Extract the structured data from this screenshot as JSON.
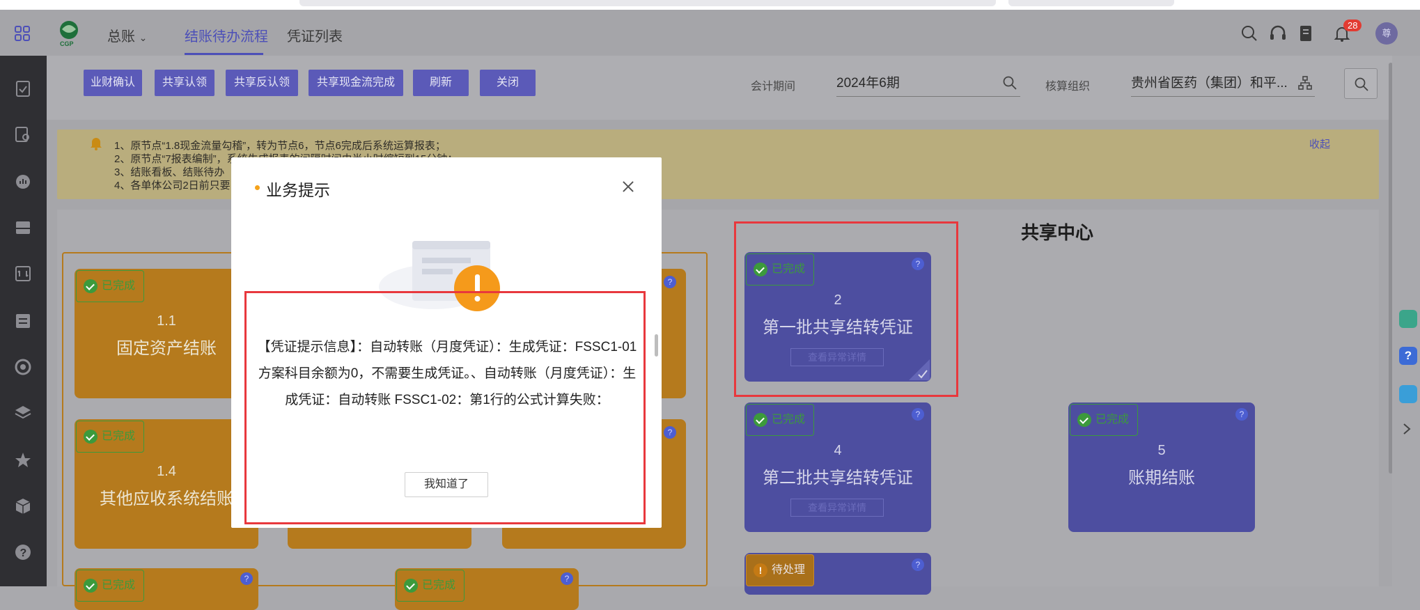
{
  "header": {
    "ledger_label": "总账",
    "tabs": [
      "结账待办流程",
      "凭证列表"
    ],
    "notification_count": "28",
    "avatar_text": "尊"
  },
  "toolbar": {
    "buttons": [
      "业财确认",
      "共享认领",
      "共享反认领",
      "共享现金流完成",
      "刷新",
      "关闭"
    ],
    "period_label": "会计期间",
    "period_value": "2024年6期",
    "org_label": "核算组织",
    "org_value": "贵州省医药（集团）和平..."
  },
  "notice": {
    "lines": [
      "1、原节点“1.8现金流量勾稽”，转为节点6，节点6完成后系统运算报表；",
      "2、原节点“7报表编制”，系统生成报表的间隔时间由半小时缩短到15分钟；",
      "3、结账看板、结账待办",
      "4、各单体公司2日前只要"
    ],
    "collapse_label": "收起"
  },
  "cards_left": [
    {
      "status": "已完成",
      "num": "1.1",
      "title": "固定资产结账"
    },
    {
      "status": "已完成",
      "num": "1.4",
      "title": "其他应收系统结账"
    },
    {
      "status": "已完成",
      "num": "",
      "title": ""
    },
    {
      "status": "已完成",
      "num": "",
      "title": ""
    }
  ],
  "shared_center": {
    "title": "共享中心",
    "cards": [
      {
        "status": "已完成",
        "num": "2",
        "title": "第一批共享结转凭证",
        "link": "查看异常详情"
      },
      {
        "status": "已完成",
        "num": "4",
        "title": "第二批共享结转凭证",
        "link": "查看异常详情"
      },
      {
        "status": "已完成",
        "num": "5",
        "title": "账期结账"
      },
      {
        "status": "待处理"
      }
    ]
  },
  "modal": {
    "title": "业务提示",
    "message": "【凭证提示信息】：自动转账（月度凭证）：生成凭证：FSSC1-01方案科目余额为0，不需要生成凭证。、自动转账（月度凭证）：生成凭证：自动转账 FSSC1-02：第1行的公式计算失败：",
    "confirm_label": "我知道了"
  },
  "colors": {
    "accent": "#4c4fb8",
    "card_orange": "#b57a1d",
    "card_blue": "#4d4ea0",
    "highlight_red": "#e8383d",
    "warning_orange": "#f5a21b"
  }
}
